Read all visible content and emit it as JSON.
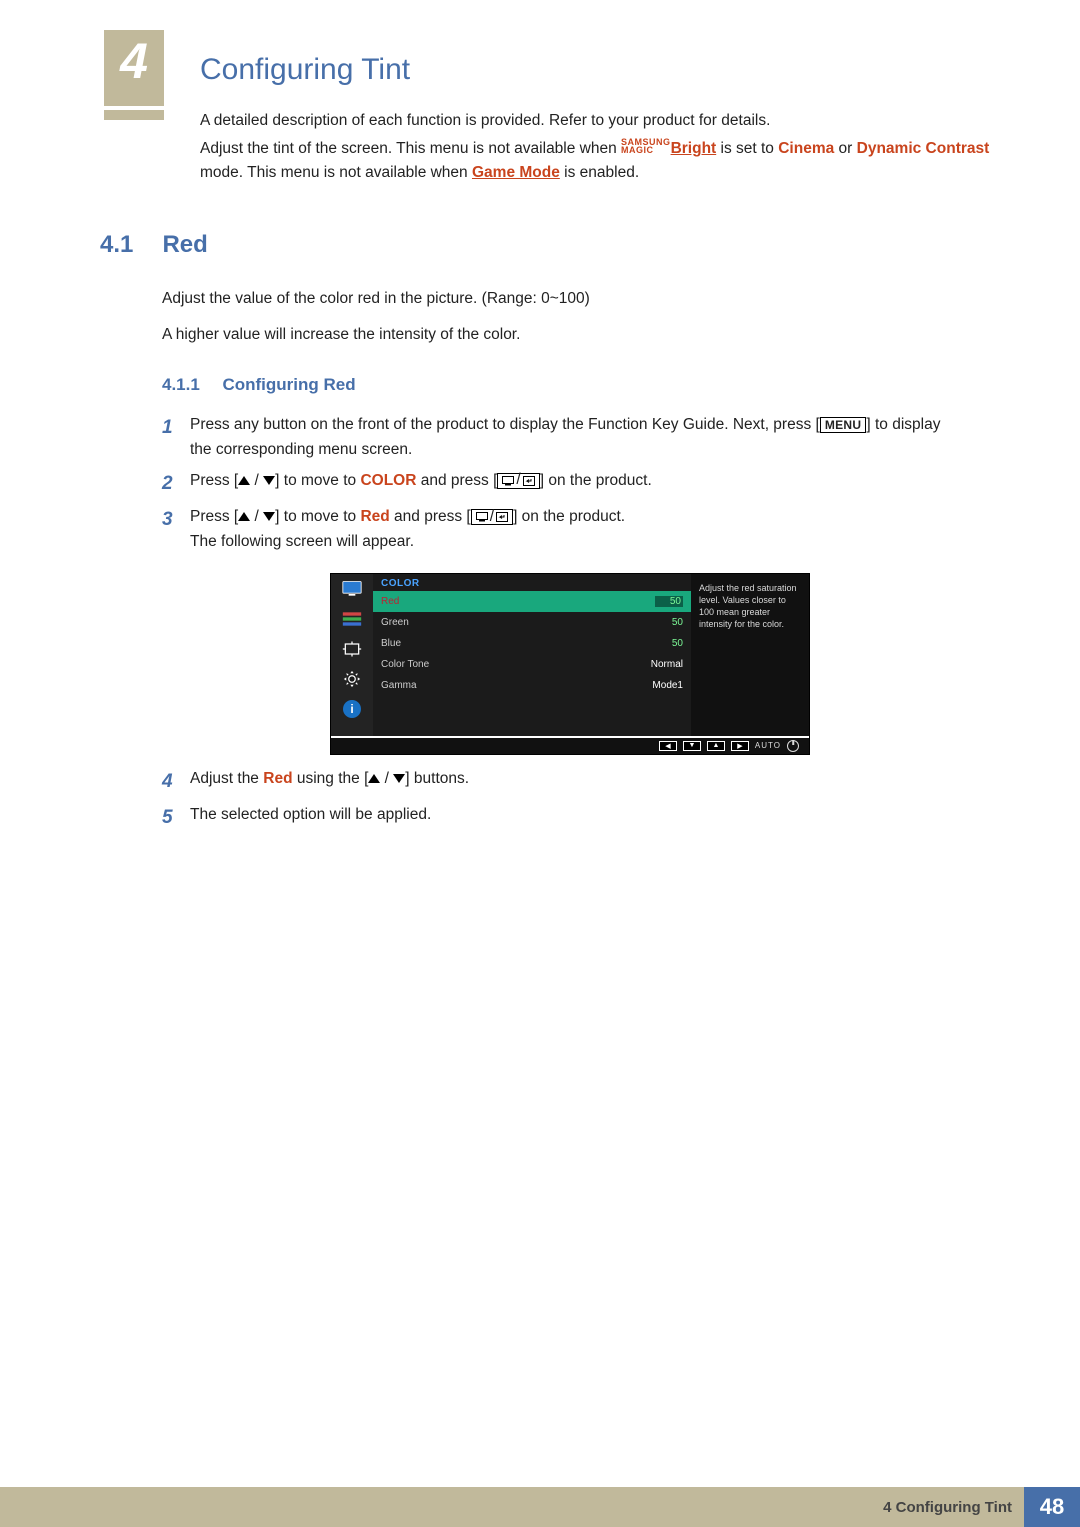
{
  "chapter": {
    "number": "4",
    "title": "Configuring Tint"
  },
  "intro": {
    "line1": "A detailed description of each function is provided. Refer to your product for details.",
    "line2a": "Adjust the tint of the screen. This menu is not available when ",
    "brand_top": "SAMSUNG",
    "brand_bottom": "MAGIC",
    "bright": "Bright",
    "line2b": " is set to ",
    "cinema": "Cinema",
    "line2c": " or ",
    "dynamic": "Dynamic Contrast",
    "line2d": " mode. This menu is not available when ",
    "gamemode": "Game Mode",
    "line2e": " is enabled."
  },
  "section": {
    "number": "4.1",
    "title": "Red"
  },
  "body": {
    "p1": "Adjust the value of the color red in the picture. (Range: 0~100)",
    "p2": "A higher value will increase the intensity of the color."
  },
  "subsection": {
    "number": "4.1.1",
    "title": "Configuring Red"
  },
  "steps": {
    "s1a": "Press any button on the front of the product to display the Function Key Guide. Next, press [",
    "s1menu": "MENU",
    "s1b": "] to display the corresponding menu screen.",
    "s2a": "Press [",
    "s2b": "] to move to ",
    "s2color": "COLOR",
    "s2c": " and press [",
    "s2d": "] on the product.",
    "s3a": "Press [",
    "s3b": "] to move to ",
    "s3red": "Red",
    "s3c": " and press [",
    "s3d": "] on the product.",
    "s3e": "The following screen will appear.",
    "s4a": "Adjust the ",
    "s4red": "Red",
    "s4b": " using the [",
    "s4c": "] buttons.",
    "s5": "The selected option will be applied."
  },
  "osd": {
    "header": "COLOR",
    "rows": {
      "red": {
        "label": "Red",
        "value": "50"
      },
      "green": {
        "label": "Green",
        "value": "50"
      },
      "blue": {
        "label": "Blue",
        "value": "50"
      },
      "colortone": {
        "label": "Color Tone",
        "value": "Normal"
      },
      "gamma": {
        "label": "Gamma",
        "value": "Mode1"
      }
    },
    "help": "Adjust the red saturation level. Values closer to 100 mean greater intensity for the color.",
    "auto": "AUTO"
  },
  "footer": {
    "text": "4 Configuring Tint",
    "page": "48"
  }
}
